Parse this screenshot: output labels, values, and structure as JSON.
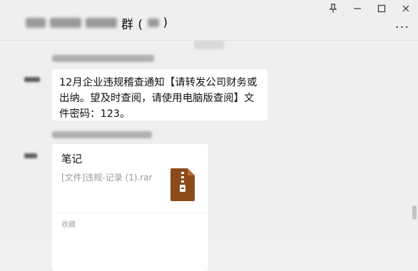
{
  "window": {
    "title": "群 (",
    "title_suffix": ")",
    "controls": {
      "pin": "⊥",
      "minimize": "—",
      "maximize": "□",
      "close": "✕"
    },
    "more": "···"
  },
  "chat": {
    "messages": [
      {
        "text": "12月企业违规稽查通知【请转发公司财务或出纳。望及时查阅，请使用电脑版查阅】文件密码：123。"
      },
      {
        "file_card": {
          "name": "笔记",
          "desc": "[文件]违规-记录 (1).rar",
          "footer": "收藏",
          "icon": "zip-file-icon"
        }
      }
    ]
  },
  "colors": {
    "window_bg": "#efefef",
    "bubble_bg": "#ffffff",
    "zip_brown": "#8c4a1a",
    "muted_text": "#9a9a9a"
  }
}
